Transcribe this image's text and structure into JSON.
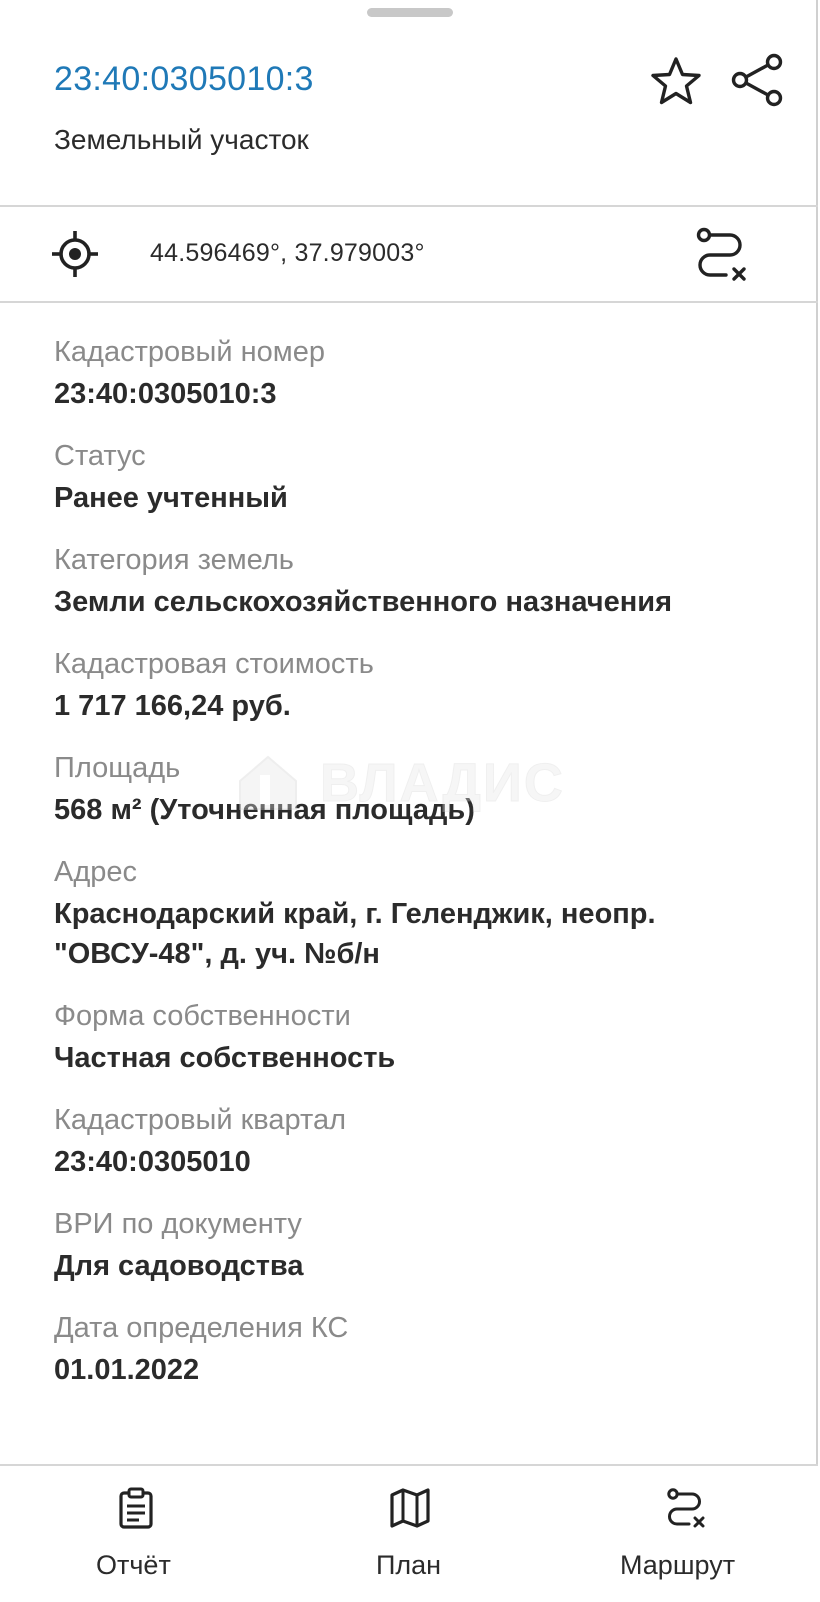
{
  "header": {
    "cadastral_number": "23:40:0305010:3",
    "object_type": "Земельный участок",
    "icons": {
      "favorite": "star-outline-icon",
      "share": "share-icon"
    }
  },
  "location": {
    "coordinates": "44.596469°, 37.979003°",
    "icons": {
      "locate": "crosshair-icon",
      "route": "route-icon"
    }
  },
  "fields": [
    {
      "label": "Кадастровый номер",
      "value": "23:40:0305010:3"
    },
    {
      "label": "Статус",
      "value": "Ранее учтенный"
    },
    {
      "label": "Категория земель",
      "value": "Земли сельскохозяйственного назначения"
    },
    {
      "label": "Кадастровая стоимость",
      "value": "1 717 166,24 руб."
    },
    {
      "label": "Площадь",
      "value": "568 м² (Уточненная площадь)"
    },
    {
      "label": "Адрес",
      "value": "Краснодарский край, г. Геленджик, неопр. \"ОВСУ-48\", д. уч. №б/н"
    },
    {
      "label": "Форма собственности",
      "value": "Частная собственность"
    },
    {
      "label": "Кадастровый квартал",
      "value": "23:40:0305010"
    },
    {
      "label": "ВРИ по документу",
      "value": "Для садоводства"
    },
    {
      "label": "Дата определения КС",
      "value": "01.01.2022"
    }
  ],
  "watermark": {
    "text": "ВЛАДИС"
  },
  "bottom_tabs": [
    {
      "label": "Отчёт",
      "icon": "clipboard-icon"
    },
    {
      "label": "План",
      "icon": "map-icon"
    },
    {
      "label": "Маршрут",
      "icon": "route-icon"
    }
  ],
  "colors": {
    "accent": "#1f79b7",
    "label_gray": "#8a8a8a",
    "text": "#2b2b2b",
    "divider": "#d6d6d6"
  }
}
